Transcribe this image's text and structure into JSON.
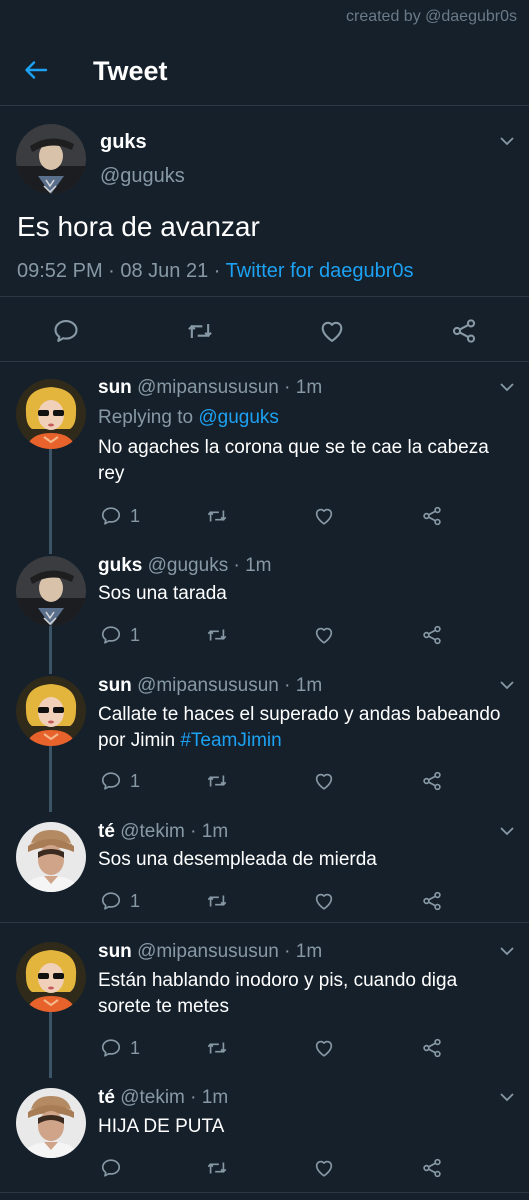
{
  "watermark": "created by @daegubr0s",
  "header": {
    "title": "Tweet"
  },
  "tweet": {
    "name": "guks",
    "handle": "@guguks",
    "text": "Es hora de avanzar",
    "time": "09:52 PM · 08 Jun 21 · ",
    "source": "Twitter for daegubr0s"
  },
  "replies": [
    {
      "name": "sun",
      "handle": "@mipansususun · 1m",
      "replying_prefix": "Replying to ",
      "replying_to": "@guguks",
      "text": "No agaches la corona que se te cae la cabeza rey",
      "replies": "1"
    },
    {
      "name": "guks",
      "handle": "@guguks · 1m",
      "text": "Sos una tarada",
      "replies": "1"
    },
    {
      "name": "sun",
      "handle": "@mipansususun · 1m",
      "text": "Callate te haces el superado y andas babeando por Jimin ",
      "hashtag": "#TeamJimin",
      "replies": "1"
    },
    {
      "name": "té",
      "handle": "@tekim · 1m",
      "text": "Sos una desempleada de mierda",
      "replies": "1"
    },
    {
      "name": "sun",
      "handle": "@mipansususun · 1m",
      "text": "Están hablando inodoro y pis, cuando diga sorete te metes",
      "replies": "1"
    },
    {
      "name": "té",
      "handle": "@tekim · 1m",
      "text": "HIJA DE PUTA",
      "replies": ""
    }
  ],
  "colors": {
    "background": "#15202b",
    "accent": "#1da1f2",
    "muted": "#8899a6"
  },
  "icons": [
    "back-arrow-icon",
    "chevron-down-icon",
    "reply-icon",
    "retweet-icon",
    "like-icon",
    "share-icon"
  ]
}
